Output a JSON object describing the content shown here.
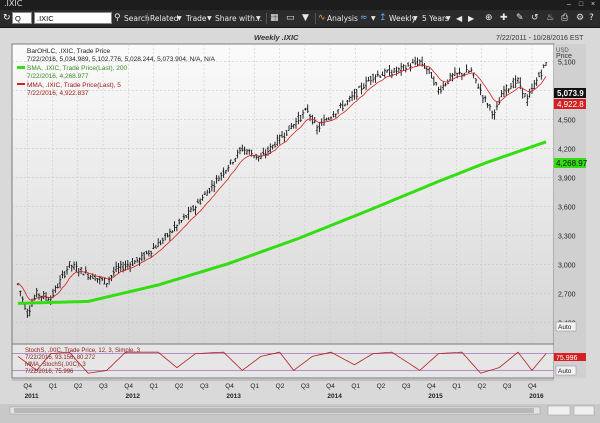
{
  "window": {
    "title": ".IXIC"
  },
  "toolbar": {
    "symbol_prefix": "Q",
    "symbol": ".IXIC",
    "search": "Search",
    "related": "Related",
    "trade": "Trade",
    "share": "Share with...",
    "analysis": "Analysis",
    "interval": "Weekly",
    "range": "5 Years",
    "colors": {
      "background": "#2b2b2b",
      "text": "#e8e8e8"
    }
  },
  "chart": {
    "title": "Weekly .IXIC",
    "date_range": "7/22/2011 - 10/28/2016 EST",
    "price_label": "Price",
    "usd_label": "USD",
    "auto_label": "Auto",
    "legend": {
      "bar": "BarOHLC, .IXIC, Trade Price",
      "bar_values": "7/22/2016, 5,034.989, 5,102.776, 5,028.244, 5,073.904, N/A, N/A",
      "sma": "SMA, .IXIC, Trade Price(Last), 200",
      "sma_values": "7/22/2016, 4,268.977",
      "mma": "MMA, .IXIC, Trade Price(Last), 5",
      "mma_values": "7/22/2016, 4,922.837"
    },
    "price_tag": "5,073.9",
    "mma_tag": "4,922.8",
    "sma_tag": "4,268.97",
    "stoch": {
      "legend1": "StochS, .IXIC, Trade Price, 12, 3, Simple, 3",
      "legend1_values": "7/22/2016, 93.156, 80.272",
      "legend2": "MMA, StochS(.IXIC), 3",
      "legend2_values": "7/22/2016, 75.996",
      "tag": "75.996",
      "auto_label": "Auto"
    },
    "colors": {
      "sma": "#33dd11",
      "mma": "#d42020",
      "bars": "#111111",
      "stoch": "#b02020"
    }
  },
  "chart_data": {
    "type": "line",
    "title": "Weekly .IXIC",
    "y_ticks": [
      "5,100",
      "4,800",
      "4,500",
      "4,200",
      "3,900",
      "3,600",
      "3,300",
      "3,000",
      "2,700",
      "2,400"
    ],
    "ylim": [
      2180,
      5280
    ],
    "x_quarters": [
      "Q4",
      "Q1",
      "Q2",
      "Q3",
      "Q4",
      "Q1",
      "Q2",
      "Q3",
      "Q4",
      "Q1",
      "Q2",
      "Q3",
      "Q4",
      "Q1",
      "Q2",
      "Q3",
      "Q4",
      "Q1",
      "Q2",
      "Q3",
      "Q4"
    ],
    "x_years": [
      "2011",
      "2012",
      "2013",
      "2014",
      "2015",
      "2016"
    ],
    "price_series": {
      "name": ".IXIC",
      "anchors": [
        [
          0,
          2800
        ],
        [
          4,
          2500
        ],
        [
          8,
          2700
        ],
        [
          14,
          2650
        ],
        [
          22,
          3000
        ],
        [
          30,
          2900
        ],
        [
          38,
          2820
        ],
        [
          42,
          2950
        ],
        [
          52,
          3050
        ],
        [
          62,
          3250
        ],
        [
          76,
          3600
        ],
        [
          86,
          3900
        ],
        [
          96,
          4200
        ],
        [
          104,
          4100
        ],
        [
          112,
          4300
        ],
        [
          118,
          4450
        ],
        [
          124,
          4600
        ],
        [
          128,
          4400
        ],
        [
          132,
          4500
        ],
        [
          142,
          4700
        ],
        [
          152,
          4950
        ],
        [
          162,
          5000
        ],
        [
          172,
          5100
        ],
        [
          176,
          5000
        ],
        [
          180,
          4800
        ],
        [
          186,
          4950
        ],
        [
          194,
          5000
        ],
        [
          200,
          4700
        ],
        [
          204,
          4550
        ],
        [
          208,
          4800
        ],
        [
          214,
          4900
        ],
        [
          218,
          4700
        ],
        [
          222,
          4900
        ],
        [
          226,
          5080
        ]
      ]
    },
    "sma_series": {
      "name": "SMA 200",
      "anchors": [
        [
          0,
          2600
        ],
        [
          30,
          2620
        ],
        [
          60,
          2790
        ],
        [
          90,
          3010
        ],
        [
          120,
          3270
        ],
        [
          150,
          3560
        ],
        [
          180,
          3860
        ],
        [
          200,
          4050
        ],
        [
          226,
          4269
        ]
      ]
    },
    "stoch_series": {
      "name": "StochS",
      "anchors": [
        [
          0,
          70
        ],
        [
          8,
          20
        ],
        [
          14,
          80
        ],
        [
          22,
          85
        ],
        [
          30,
          10
        ],
        [
          38,
          20
        ],
        [
          46,
          85
        ],
        [
          60,
          85
        ],
        [
          68,
          30
        ],
        [
          76,
          80
        ],
        [
          88,
          85
        ],
        [
          96,
          20
        ],
        [
          104,
          70
        ],
        [
          112,
          85
        ],
        [
          118,
          20
        ],
        [
          126,
          70
        ],
        [
          134,
          85
        ],
        [
          144,
          40
        ],
        [
          152,
          80
        ],
        [
          160,
          85
        ],
        [
          172,
          20
        ],
        [
          180,
          80
        ],
        [
          190,
          85
        ],
        [
          198,
          10
        ],
        [
          206,
          30
        ],
        [
          214,
          85
        ],
        [
          220,
          20
        ],
        [
          226,
          80
        ]
      ]
    }
  }
}
